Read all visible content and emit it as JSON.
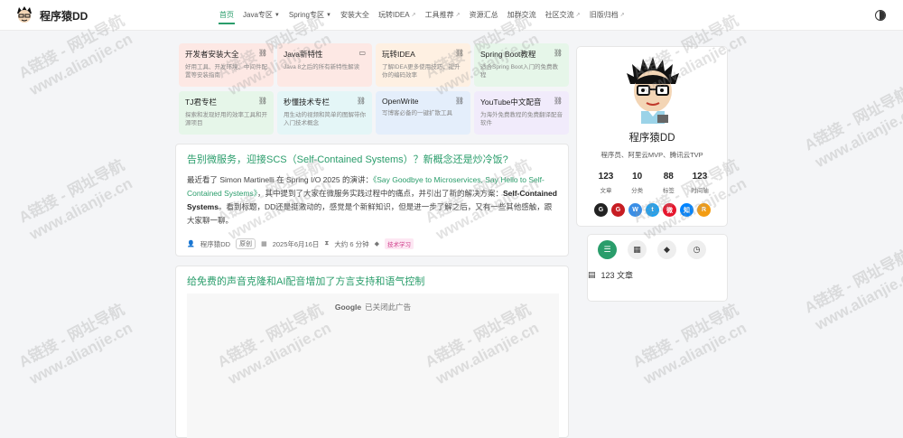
{
  "brand": {
    "name": "程序猿DD"
  },
  "nav": [
    {
      "label": "首页",
      "active": true
    },
    {
      "label": "Java专区",
      "dropdown": true
    },
    {
      "label": "Spring专区",
      "dropdown": true
    },
    {
      "label": "安装大全"
    },
    {
      "label": "玩转IDEA",
      "external": true
    },
    {
      "label": "工具推荐",
      "external": true
    },
    {
      "label": "资源汇总"
    },
    {
      "label": "加群交流"
    },
    {
      "label": "社区交流",
      "external": true
    },
    {
      "label": "旧版归档",
      "external": true
    }
  ],
  "cards": [
    {
      "title": "开发者安装大全",
      "desc": "好用工具、开发环境、中间件配置等安装指南",
      "bg": "#fde8e4",
      "icon": "link-icon"
    },
    {
      "title": "Java新特性",
      "desc": "Java 8之后的所有新特性解读",
      "bg": "#fde8e4",
      "icon": "folder-icon"
    },
    {
      "title": "玩转IDEA",
      "desc": "了解IDEA更多使用技巧，提升你的编码效率",
      "bg": "#fef0e2",
      "icon": "link-icon"
    },
    {
      "title": "Spring Boot教程",
      "desc": "适合Spring Boot入门的免费教程",
      "bg": "#e6f6e9",
      "icon": "link-icon"
    },
    {
      "title": "TJ君专栏",
      "desc": "探索和发现好用的效率工具和开源项目",
      "bg": "#e6f6e9",
      "icon": "link-icon"
    },
    {
      "title": "秒懂技术专栏",
      "desc": "用生动的视频和简单的图解带你入门技术概念",
      "bg": "#e4f6f7",
      "icon": "link-icon"
    },
    {
      "title": "OpenWrite",
      "desc": "写博客必备的一键扩散工具",
      "bg": "#e4eefb",
      "icon": "link-icon"
    },
    {
      "title": "YouTube中文配音",
      "desc": "为海外免费教程的免费翻译配音软件",
      "bg": "#f1ebfb",
      "icon": "link-icon"
    }
  ],
  "article1": {
    "title": "告别微服务，迎接SCS（Self-Contained Systems）？新概念还是炒冷饭?",
    "body_pre": "最近看了 Simon Martinelli 在 Spring I/O 2025 的演讲：",
    "body_link": "《Say Goodbye to Microservices, Say Hello to Self-Contained Systems》",
    "body_mid": "，其中提到了大家在微服务实践过程中的痛点，并引出了新的解决方案：",
    "body_bold": "Self-Contained Systems",
    "body_post": "。看到标题，DD还是挺激动的，感觉是个新鲜知识，但是进一步了解之后，又有一些其他感触，跟大家聊一聊。",
    "author": "程序猿DD",
    "original": "原创",
    "date": "2025年6月16日",
    "read_time": "大约 6 分钟",
    "tag": "技术学习"
  },
  "article2": {
    "title": "给免费的声音克隆和AI配音增加了方言支持和语气控制",
    "ad_brand": "Google",
    "ad_text": "已关闭此广告"
  },
  "profile": {
    "name": "程序猿DD",
    "desc": "程序员、阿里云MVP、腾讯云TVP",
    "stats": [
      {
        "num": "123",
        "label": "文章"
      },
      {
        "num": "10",
        "label": "分类"
      },
      {
        "num": "88",
        "label": "标签"
      },
      {
        "num": "123",
        "label": "时间轴"
      }
    ],
    "socials": [
      {
        "name": "github-icon",
        "glyph": "G",
        "color": "#222222"
      },
      {
        "name": "gitee-icon",
        "glyph": "G",
        "color": "#c71d23"
      },
      {
        "name": "wechat-icon",
        "glyph": "W",
        "color": "#3a8ee6"
      },
      {
        "name": "twitter-icon",
        "glyph": "t",
        "color": "#1da1f2"
      },
      {
        "name": "weibo-icon",
        "glyph": "微",
        "color": "#e6162d"
      },
      {
        "name": "zhihu-icon",
        "glyph": "知",
        "color": "#0084ff"
      },
      {
        "name": "rss-icon",
        "glyph": "R",
        "color": "#f39c12"
      }
    ]
  },
  "sidebar_tabs": {
    "count_label": "123 文章"
  },
  "watermark": {
    "line1": "A链接 - 网址导航",
    "line2": "www.alianjie.cn"
  }
}
